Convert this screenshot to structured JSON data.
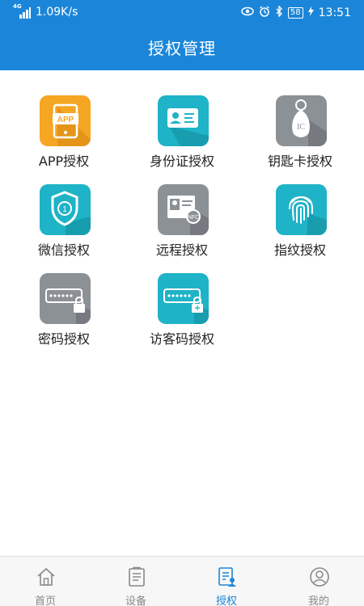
{
  "status_bar": {
    "network_type": "4G",
    "speed": "1.09K/s",
    "battery": "58",
    "time": "13:51"
  },
  "header": {
    "title": "授权管理"
  },
  "grid": [
    {
      "label": "APP授权",
      "icon": "app-icon",
      "color": "#f5a623"
    },
    {
      "label": "身份证授权",
      "icon": "id-card-icon",
      "color": "#1fb3c7"
    },
    {
      "label": "钥匙卡授权",
      "icon": "ic-key-fob-icon",
      "color": "#8c9196"
    },
    {
      "label": "微信授权",
      "icon": "wechat-shield-icon",
      "color": "#1fb3c7"
    },
    {
      "label": "远程授权",
      "icon": "nfc-card-icon",
      "color": "#8c9196"
    },
    {
      "label": "指纹授权",
      "icon": "fingerprint-icon",
      "color": "#1fb3c7"
    },
    {
      "label": "密码授权",
      "icon": "password-lock-icon",
      "color": "#8c9196"
    },
    {
      "label": "访客码授权",
      "icon": "visitor-code-icon",
      "color": "#1fb3c7"
    }
  ],
  "tabbar": [
    {
      "label": "首页",
      "icon": "home-icon",
      "active": false
    },
    {
      "label": "设备",
      "icon": "device-icon",
      "active": false
    },
    {
      "label": "授权",
      "icon": "authorize-icon",
      "active": true
    },
    {
      "label": "我的",
      "icon": "profile-icon",
      "active": false
    }
  ],
  "colors": {
    "primary": "#1b86d9",
    "inactive": "#888888"
  }
}
